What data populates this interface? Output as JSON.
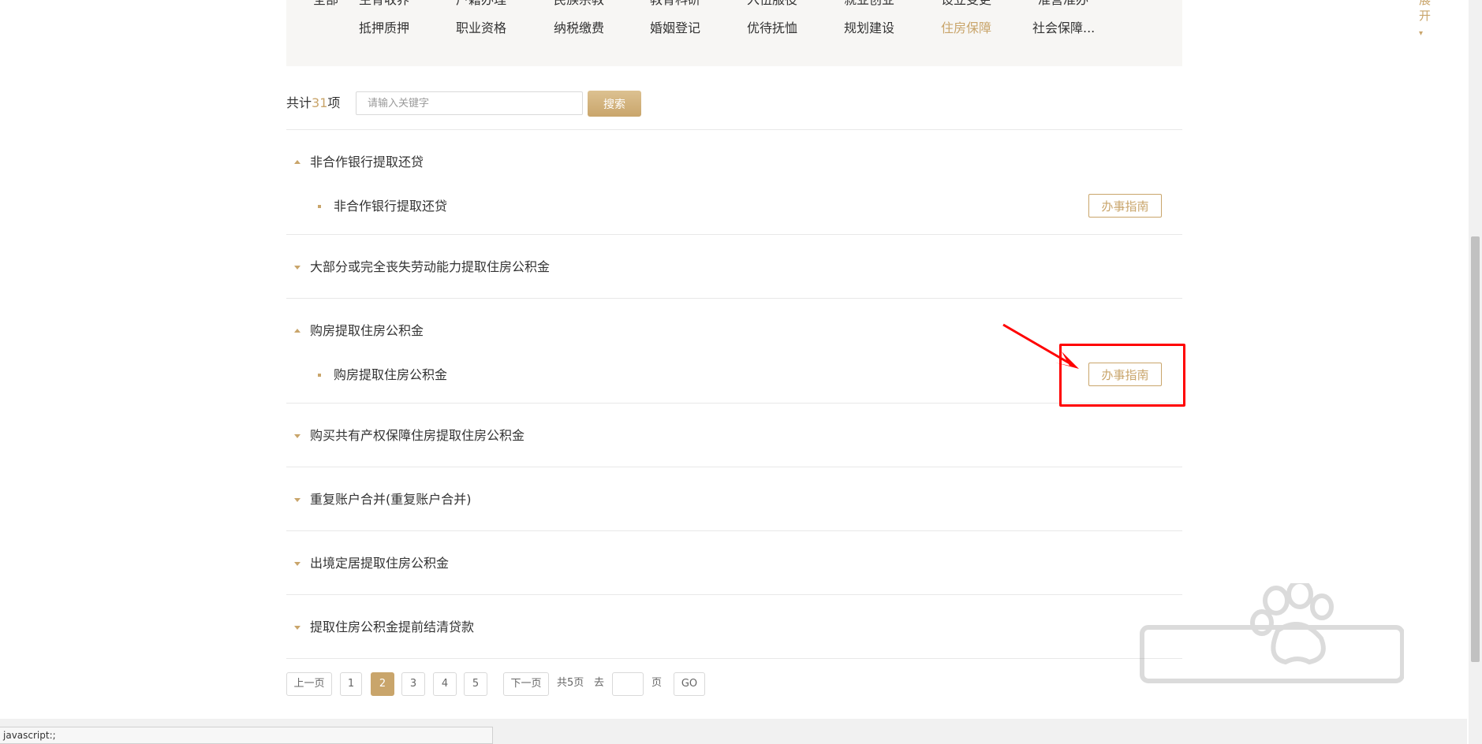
{
  "categories": {
    "row1": [
      "全部",
      "生育收养",
      "户籍办理",
      "民族宗教",
      "教育科研",
      "入伍服役",
      "就业创业",
      "设立变更",
      "准营准办"
    ],
    "row2": [
      "抵押质押",
      "职业资格",
      "纳税缴费",
      "婚姻登记",
      "优待抚恤",
      "规划建设",
      "住房保障",
      "社会保障..."
    ],
    "active": "住房保障",
    "expand_label": "展开"
  },
  "search": {
    "count_prefix": "共计",
    "count": "31",
    "count_suffix": "项",
    "placeholder": "请输入关键字",
    "button_label": "搜索"
  },
  "groups": [
    {
      "title": "非合作银行提取还贷",
      "expanded": true,
      "sub": "非合作银行提取还贷",
      "guide_label": "办事指南"
    },
    {
      "title": "大部分或完全丧失劳动能力提取住房公积金",
      "expanded": false
    },
    {
      "title": "购房提取住房公积金",
      "expanded": true,
      "sub": "购房提取住房公积金",
      "guide_label": "办事指南"
    },
    {
      "title": "购买共有产权保障住房提取住房公积金",
      "expanded": false
    },
    {
      "title": "重复账户合并(重复账户合并)",
      "expanded": false
    },
    {
      "title": "出境定居提取住房公积金",
      "expanded": false
    },
    {
      "title": "提取住房公积金提前结清贷款",
      "expanded": false
    }
  ],
  "pagination": {
    "prev_label": "上一页",
    "pages": [
      "1",
      "2",
      "3",
      "4",
      "5"
    ],
    "current": "2",
    "next_label": "下一页",
    "total_label": "共5页",
    "goto_label": "去",
    "page_unit": "页",
    "go_label": "GO"
  },
  "status_bar": {
    "text": "javascript:;"
  },
  "colors": {
    "accent": "#c9a56b",
    "annotation": "#ff0000"
  }
}
